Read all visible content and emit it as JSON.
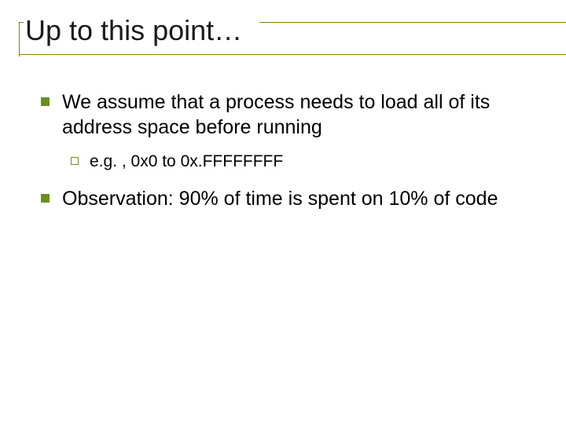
{
  "slide": {
    "title": "Up to this point…",
    "bullets": [
      {
        "text": "We assume that a process needs to load all of its address space before running",
        "sub": [
          {
            "text": "e.g. , 0x0 to 0x.FFFFFFFF"
          }
        ]
      },
      {
        "text": "Observation:  90% of time is spent on 10% of code",
        "sub": []
      }
    ]
  }
}
